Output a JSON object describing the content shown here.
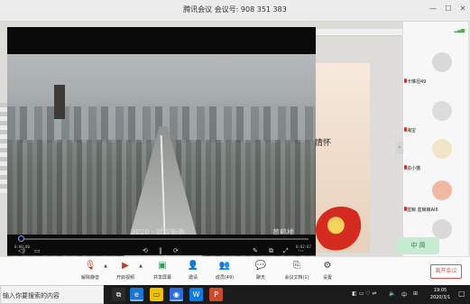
{
  "window": {
    "title": "腾讯会议 会议号: 908 351 383"
  },
  "shared_screen": {
    "doc_text": "情怀"
  },
  "player": {
    "current_time": "0:00:00",
    "total_time": "0:02:07",
    "progress_fraction": 0.01,
    "caption": "2020 · 武汉新春",
    "watermark": "黄鹤楼"
  },
  "participants": [
    {
      "name": "卡琳坦49",
      "avatar_color": "#d9d9d9"
    },
    {
      "name": "海宝",
      "avatar_color": "#dcdcdc"
    },
    {
      "name": "渝小猫",
      "avatar_color": "#f1e4c9"
    },
    {
      "name": "蓝鲸 蓝鲸鲸AI6",
      "avatar_color": "#f0b8a0"
    },
    {
      "name": "",
      "avatar_color": "#d9d9d9"
    }
  ],
  "raise_hand": {
    "label": "中 简"
  },
  "toolbar": {
    "items": [
      {
        "label": "解除静音",
        "icon": "mic-muted-icon"
      },
      {
        "label": "开启视频",
        "icon": "video-off-icon"
      },
      {
        "label": "共享屏幕",
        "icon": "screen-share-icon"
      },
      {
        "label": "邀请",
        "icon": "invite-icon"
      },
      {
        "label": "成员(49)",
        "icon": "members-icon"
      },
      {
        "label": "聊天",
        "icon": "chat-icon"
      },
      {
        "label": "会议文档(1)",
        "icon": "documents-icon"
      },
      {
        "label": "设置",
        "icon": "settings-icon"
      }
    ],
    "leave_label": "离开会议"
  },
  "taskbar": {
    "search_placeholder": "输入你要搜索的内容",
    "time": "19:05",
    "date": "2020/3/1",
    "ime": "中"
  },
  "colors": {
    "accent": "#6aa9ff",
    "leave": "#d9534f",
    "hand": "#c8ead2"
  }
}
